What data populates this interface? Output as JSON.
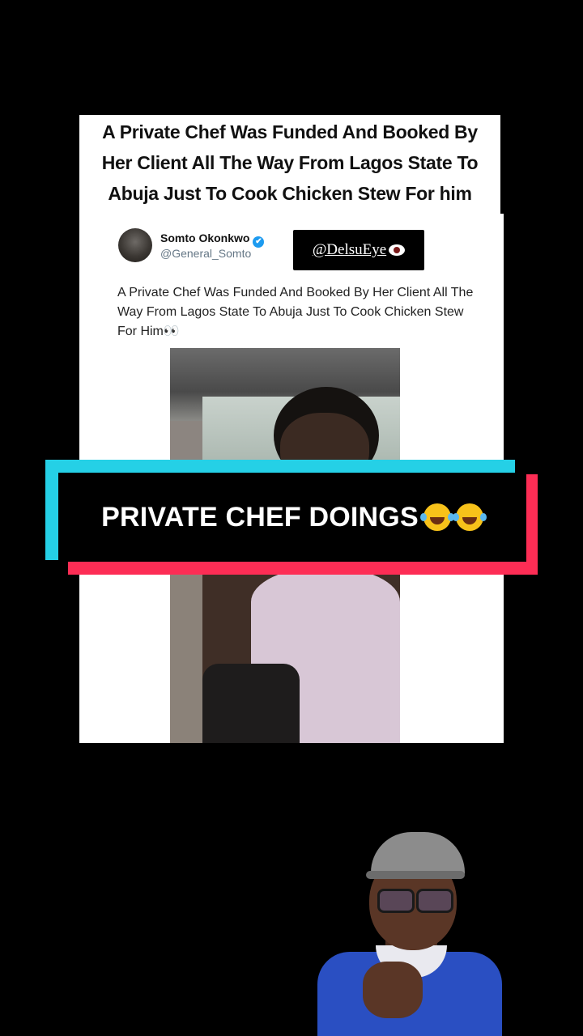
{
  "headline": {
    "lines": [
      "A Private Chef Was Funded And Booked By",
      "Her Client All The Way From Lagos State To",
      "Abuja Just To Cook Chicken Stew For him"
    ]
  },
  "tweet": {
    "author_name": "Somto Okonkwo",
    "verified_icon": "✔",
    "handle": "@General_Somto",
    "watermark": "@DelsuEye",
    "text": "A Private Chef Was Funded And Booked By Her Client All The Way From Lagos State To Abuja Just To Cook Chicken Stew For Him👀"
  },
  "banner": {
    "label": "PRIVATE CHEF DOINGS",
    "emoji": "tears-of-joy-icon"
  },
  "colors": {
    "banner_cyan": "#25d0e6",
    "banner_red": "#fd2d55",
    "verified_blue": "#1d9bf0"
  }
}
